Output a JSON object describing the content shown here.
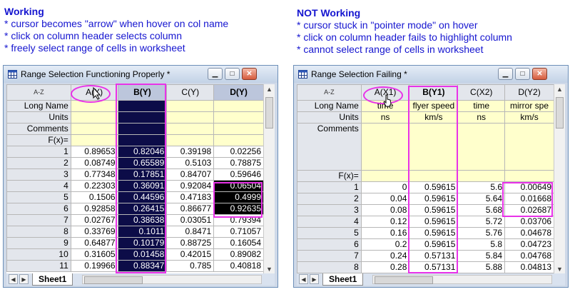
{
  "left_note": {
    "heading": "Working",
    "lines": [
      "* cursor becomes \"arrow\" when hover on col name",
      "* click on column header selects column",
      "* freely select range of cells in worksheet"
    ]
  },
  "right_note": {
    "heading": "NOT Working",
    "lines": [
      "* cursor stuck in \"pointer mode\" on hover",
      "* click on column header fails to highlight column",
      "* cannot select range of cells in worksheet"
    ]
  },
  "left_window": {
    "title": "Range Selection Functioning Properly *",
    "corner_label": "A-Z",
    "columns": [
      "A(X)",
      "B(Y)",
      "C(Y)",
      "D(Y)"
    ],
    "meta_labels": [
      "Long Name",
      "Units",
      "Comments",
      "F(x)="
    ],
    "rows": [
      [
        "1",
        "0.89653",
        "0.82046",
        "0.39198",
        "0.02256"
      ],
      [
        "2",
        "0.08749",
        "0.65589",
        "0.5103",
        "0.78875"
      ],
      [
        "3",
        "0.77348",
        "0.17851",
        "0.84707",
        "0.59646"
      ],
      [
        "4",
        "0.22303",
        "0.36091",
        "0.92084",
        "0.06504"
      ],
      [
        "5",
        "0.1506",
        "0.44596",
        "0.47183",
        "0.4999"
      ],
      [
        "6",
        "0.92858",
        "0.26415",
        "0.86677",
        "0.92635"
      ],
      [
        "7",
        "0.02767",
        "0.38638",
        "0.03051",
        "0.79394"
      ],
      [
        "8",
        "0.33769",
        "0.1011",
        "0.8471",
        "0.71057"
      ],
      [
        "9",
        "0.64877",
        "0.10179",
        "0.88725",
        "0.16054"
      ],
      [
        "10",
        "0.31605",
        "0.01458",
        "0.42015",
        "0.89082"
      ],
      [
        "11",
        "0.19966",
        "0.88347",
        "0.785",
        "0.40818"
      ]
    ],
    "sheet_tab": "Sheet1"
  },
  "right_window": {
    "title": "Range Selection Failing *",
    "corner_label": "A-Z",
    "columns": [
      "A(X1)",
      "B(Y1)",
      "C(X2)",
      "D(Y2)"
    ],
    "meta_labels": [
      "Long Name",
      "Units",
      "Comments",
      "F(x)="
    ],
    "long_names": [
      "time",
      "flyer speed",
      "time",
      "mirror spe"
    ],
    "units": [
      "ns",
      "km/s",
      "ns",
      "km/s"
    ],
    "rows": [
      [
        "1",
        "0",
        "0.59615",
        "5.6",
        "0.00649"
      ],
      [
        "2",
        "0.04",
        "0.59615",
        "5.64",
        "0.01668"
      ],
      [
        "3",
        "0.08",
        "0.59615",
        "5.68",
        "0.02687"
      ],
      [
        "4",
        "0.12",
        "0.59615",
        "5.72",
        "0.03706"
      ],
      [
        "5",
        "0.16",
        "0.59615",
        "5.76",
        "0.04678"
      ],
      [
        "6",
        "0.2",
        "0.59615",
        "5.8",
        "0.04723"
      ],
      [
        "7",
        "0.24",
        "0.57131",
        "5.84",
        "0.04768"
      ],
      [
        "8",
        "0.28",
        "0.57131",
        "5.88",
        "0.04813"
      ]
    ],
    "sheet_tab": "Sheet1"
  },
  "window_buttons": {
    "minimize": "▁",
    "maximize": "□",
    "close": "✕"
  },
  "icons": [
    "worksheet-icon",
    "minimize-icon",
    "maximize-icon",
    "close-icon",
    "arrow-cursor-icon",
    "pointer-cursor-icon",
    "scroll-up-icon",
    "scroll-down-icon"
  ],
  "colors": {
    "note_text": "#1515d0",
    "annotation_highlight": "#e832e8",
    "selected_column": "#0c0c48",
    "metadata_row": "#ffffcc",
    "window_frame": "#cfd9e8"
  }
}
